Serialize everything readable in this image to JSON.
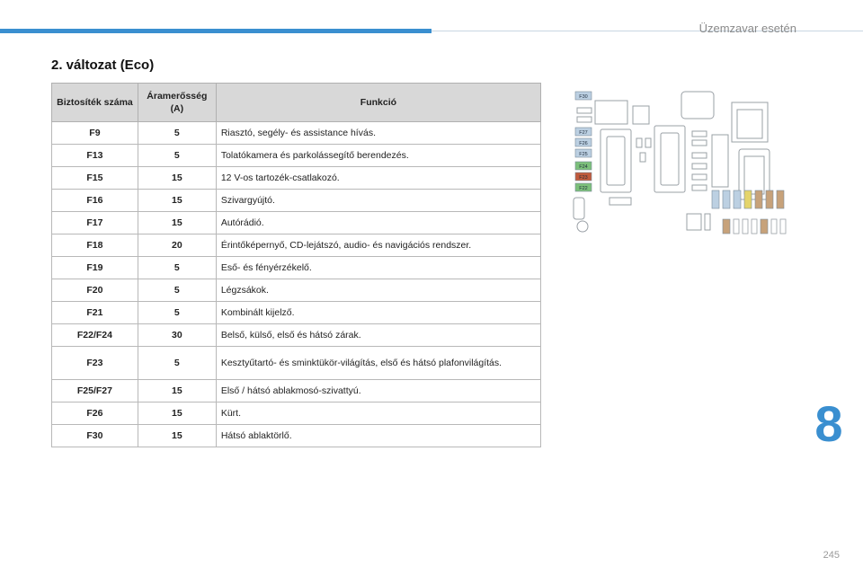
{
  "header": {
    "section_title": "Üzemzavar esetén"
  },
  "heading": "2. változat (Eco)",
  "table": {
    "columns": [
      "Biztosíték száma",
      "Áramerősség (A)",
      "Funkció"
    ],
    "rows": [
      {
        "fuse": "F9",
        "amp": "5",
        "func": "Riasztó, segély- és assistance hívás."
      },
      {
        "fuse": "F13",
        "amp": "5",
        "func": "Tolatókamera és parkolássegítő berendezés."
      },
      {
        "fuse": "F15",
        "amp": "15",
        "func": "12 V-os tartozék-csatlakozó."
      },
      {
        "fuse": "F16",
        "amp": "15",
        "func": "Szivargyújtó."
      },
      {
        "fuse": "F17",
        "amp": "15",
        "func": "Autórádió."
      },
      {
        "fuse": "F18",
        "amp": "20",
        "func": "Érintőképernyő, CD-lejátszó, audio- és navigációs rendszer."
      },
      {
        "fuse": "F19",
        "amp": "5",
        "func": "Eső- és fényérzékelő."
      },
      {
        "fuse": "F20",
        "amp": "5",
        "func": "Légzsákok."
      },
      {
        "fuse": "F21",
        "amp": "5",
        "func": "Kombinált kijelző."
      },
      {
        "fuse": "F22/F24",
        "amp": "30",
        "func": "Belső, külső, első és hátsó zárak."
      },
      {
        "fuse": "F23",
        "amp": "5",
        "func": "Kesztyűtartó- és sminktükör-világítás, első és hátsó plafonvilágítás."
      },
      {
        "fuse": "F25/F27",
        "amp": "15",
        "func": "Első / hátsó ablakmosó-szivattyú."
      },
      {
        "fuse": "F26",
        "amp": "15",
        "func": "Kürt."
      },
      {
        "fuse": "F30",
        "amp": "15",
        "func": "Hátsó ablaktörlő."
      }
    ]
  },
  "diagram": {
    "left_labels": [
      "F30",
      "F27",
      "F26",
      "F25",
      "F24",
      "F23",
      "F22"
    ],
    "left_label_colors": [
      "#bcd0e2",
      "#bcd0e2",
      "#bcd0e2",
      "#bcd0e2",
      "#7cc07a",
      "#c05a3c",
      "#7cc07a"
    ]
  },
  "chapter": "8",
  "page_number": "245"
}
